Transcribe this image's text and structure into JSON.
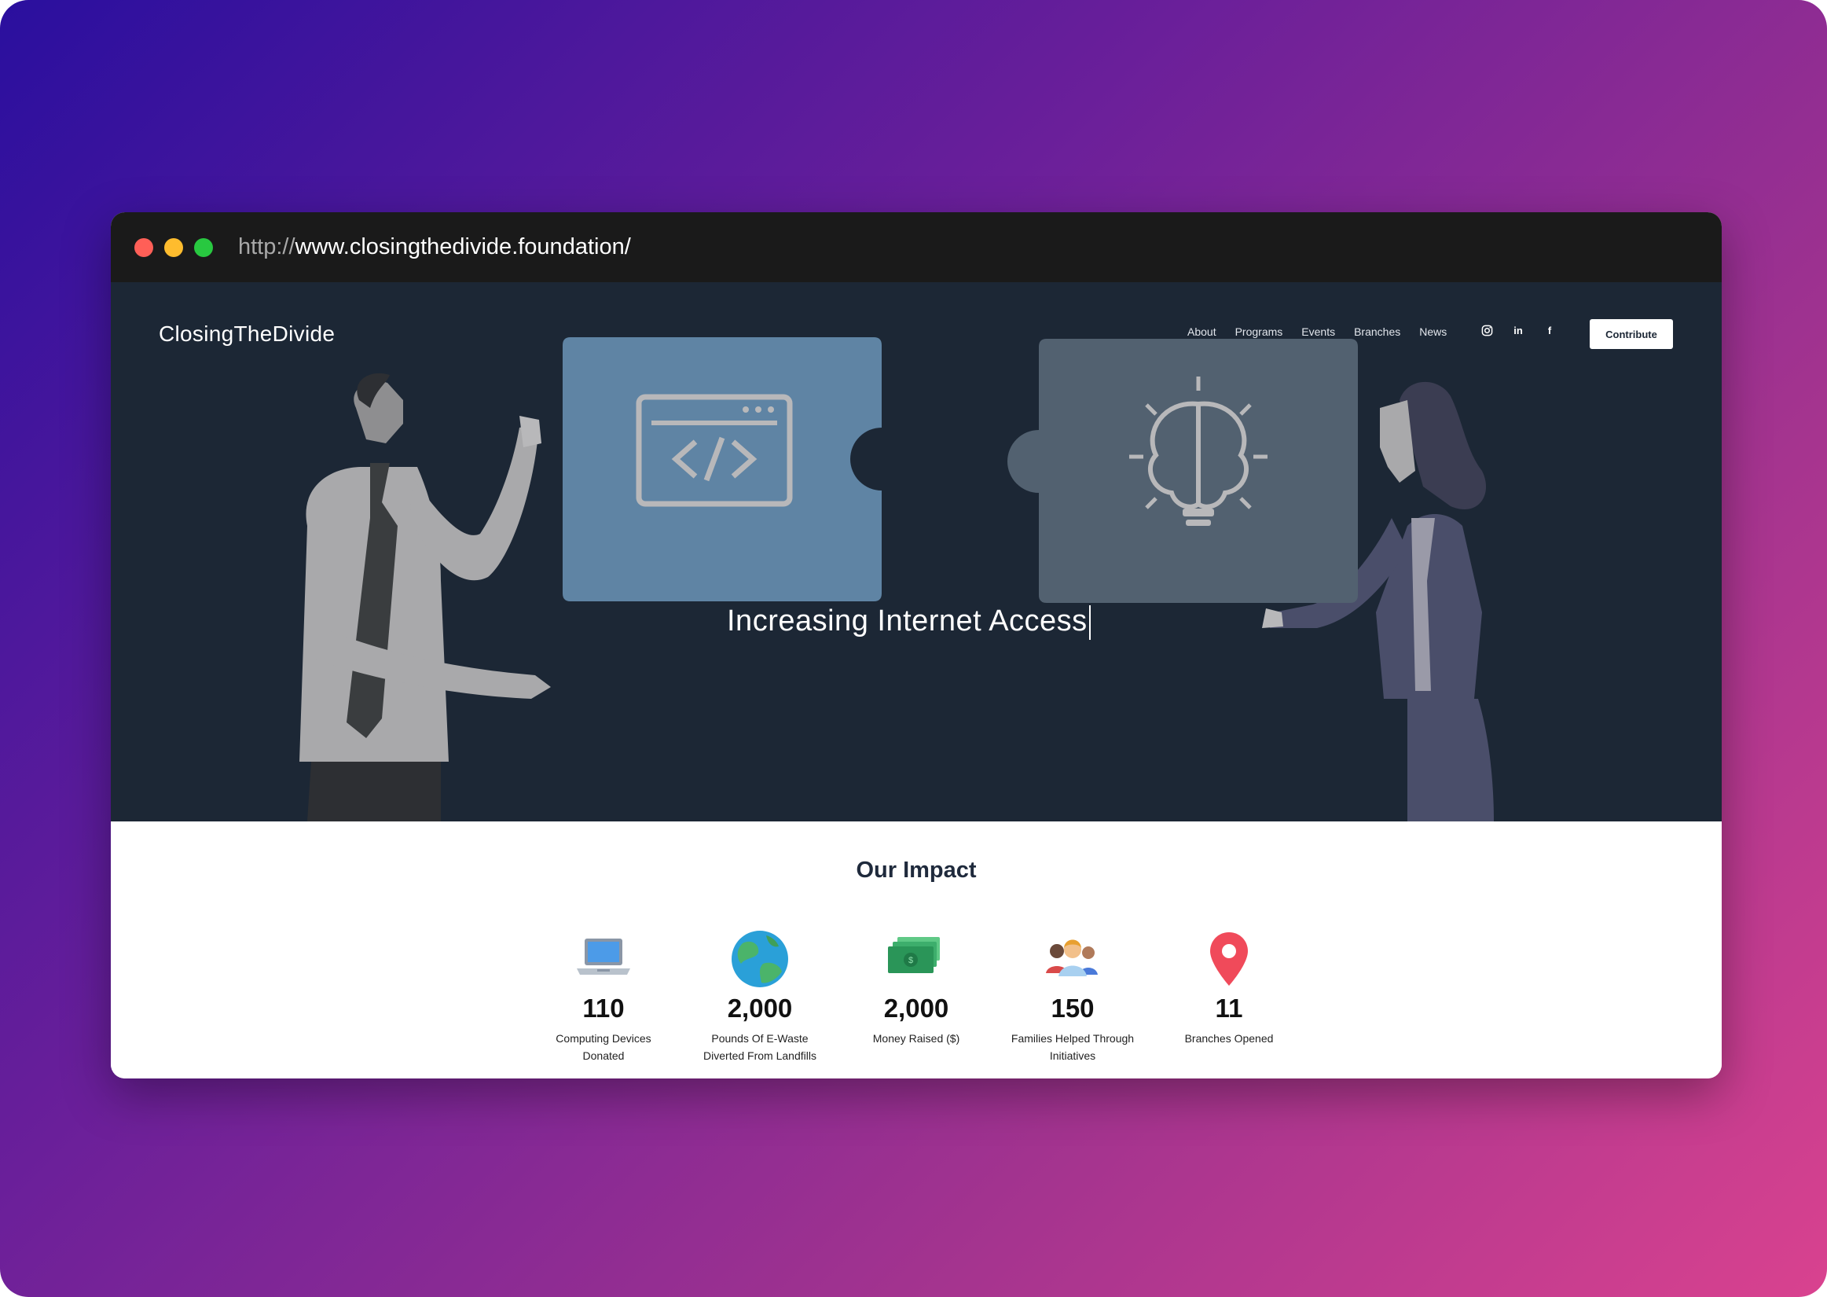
{
  "browser": {
    "url_proto": "http://",
    "url_rest": "www.closingthedivide.foundation/"
  },
  "header": {
    "brand": "ClosingTheDivide",
    "nav": [
      "About",
      "Programs",
      "Events",
      "Branches",
      "News"
    ],
    "social": [
      "instagram-icon",
      "linkedin-icon",
      "facebook-icon"
    ],
    "linkedin_glyph": "in",
    "facebook_glyph": "f",
    "contribute_label": "Contribute"
  },
  "hero": {
    "tagline": "Increasing Internet Access"
  },
  "impact": {
    "title": "Our Impact",
    "stats": [
      {
        "icon": "laptop-icon",
        "value": "110",
        "label_line1": "Computing Devices",
        "label_line2": "Donated"
      },
      {
        "icon": "globe-icon",
        "value": "2,000",
        "label_line1": "Pounds Of E-Waste",
        "label_line2": "Diverted From Landfills"
      },
      {
        "icon": "money-icon",
        "value": "2,000",
        "label_line1": "Money Raised ($)",
        "label_line2": ""
      },
      {
        "icon": "family-icon",
        "value": "150",
        "label_line1": "Families Helped Through",
        "label_line2": "Initiatives"
      },
      {
        "icon": "map-pin-icon",
        "value": "11",
        "label_line1": "Branches Opened",
        "label_line2": ""
      }
    ]
  },
  "colors": {
    "hero_bg": "#1c2735",
    "puzzle_left": "#5f84a4",
    "puzzle_right": "#526170",
    "accent_title": "#1f2a3c"
  }
}
